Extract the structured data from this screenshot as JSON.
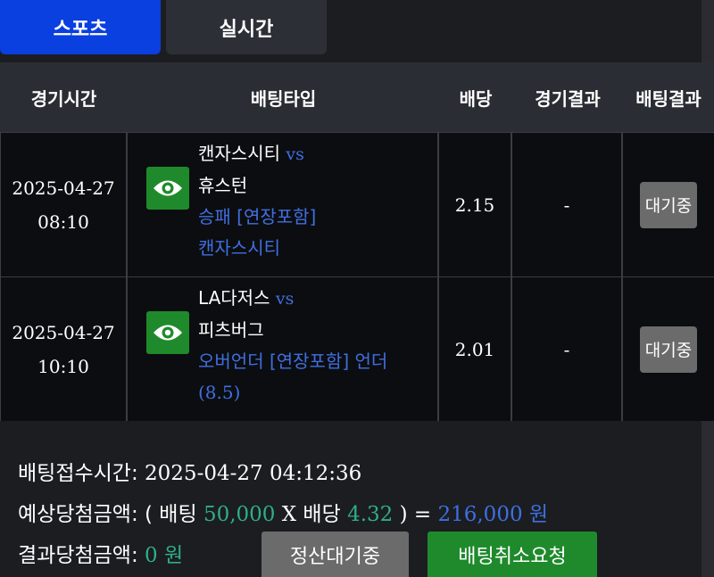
{
  "tabs": [
    {
      "label": "스포츠",
      "active": true
    },
    {
      "label": "실시간",
      "active": false
    }
  ],
  "table": {
    "headers": [
      "경기시간",
      "배팅타입",
      "배당",
      "경기결과",
      "배팅결과"
    ],
    "rows": [
      {
        "date": "2025-04-27",
        "time": "08:10",
        "home": "캔자스시티",
        "vs": "vs",
        "away": "휴스턴",
        "bet_type": "승패 [연장포함]",
        "pick": "캔자스시티",
        "pick_extra": "",
        "odds": "2.15",
        "result": "-",
        "status": "대기중"
      },
      {
        "date": "2025-04-27",
        "time": "10:10",
        "home": "LA다저스",
        "vs": "vs",
        "away": "피츠버그",
        "bet_type": "오버언더 [연장포함]",
        "pick": "언더",
        "pick_extra": "(8.5)",
        "odds": "2.01",
        "result": "-",
        "status": "대기중"
      }
    ]
  },
  "summary": {
    "accept_label": "배팅접수시간: ",
    "accept_time": "2025-04-27 04:12:36",
    "expected_label": "예상당첨금액: ( 배팅 ",
    "bet_amount": "50,000",
    "x_odds": " X 배당 ",
    "total_odds": "4.32",
    "equals": " ) = ",
    "expected_amount": "216,000 원",
    "result_label": "결과당첨금액: ",
    "result_amount": "0 원"
  },
  "buttons": {
    "settle_pending": "정산대기중",
    "cancel_request": "배팅취소요청"
  },
  "icons": {
    "view": "eye-icon"
  },
  "colors": {
    "active_tab": "#0a3fe0",
    "accent_blue": "#3f6fe0",
    "accent_green": "#2fae86",
    "button_green": "#1f8a2c",
    "button_gray": "#6b6b6b"
  }
}
